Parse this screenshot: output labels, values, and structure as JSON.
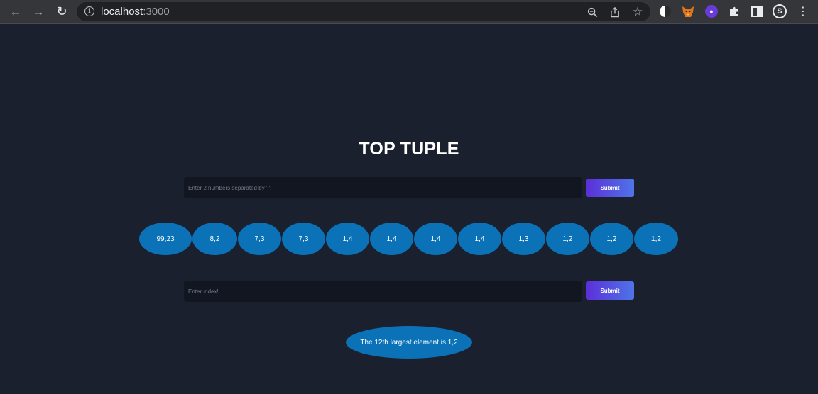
{
  "browser": {
    "url_host": "localhost",
    "url_port": ":3000"
  },
  "page": {
    "title": "TOP TUPLE",
    "tuple_form": {
      "placeholder": "Enter 2 numbers separated by ','!",
      "submit_label": "Submit"
    },
    "tuples": [
      "99,23",
      "8,2",
      "7,3",
      "7,3",
      "1,4",
      "1,4",
      "1,4",
      "1,4",
      "1,3",
      "1,2",
      "1,2",
      "1,2"
    ],
    "index_form": {
      "placeholder": "Enter index!",
      "submit_label": "Submit"
    },
    "result_text": "The 12th largest element is 1,2"
  },
  "colors": {
    "background": "#1b202e",
    "bubble": "#0b72b8",
    "button_start": "#5b2fd9",
    "button_end": "#4f74e8"
  }
}
